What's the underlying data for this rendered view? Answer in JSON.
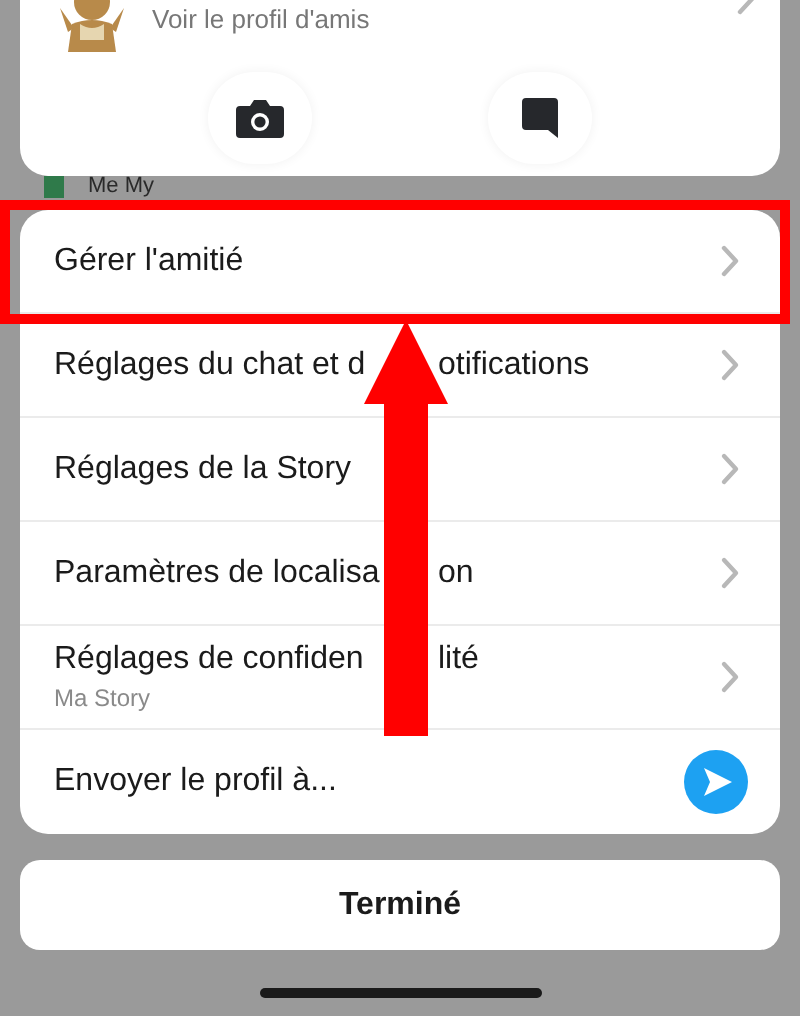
{
  "profile_card": {
    "subtitle": "Voir le profil d'amis",
    "actions": [
      {
        "kind": "camera"
      },
      {
        "kind": "chat"
      }
    ]
  },
  "background_row": {
    "label": "Me My"
  },
  "menu": [
    {
      "label_parts": [
        "Gérer l'amitié"
      ],
      "kind": "chevron",
      "highlighted": true
    },
    {
      "label_parts": [
        "Réglages du chat et d",
        "otifications"
      ],
      "kind": "chevron",
      "highlighted": false
    },
    {
      "label_parts": [
        "Réglages de la Story"
      ],
      "kind": "chevron",
      "highlighted": false
    },
    {
      "label_parts": [
        "Paramètres de localisa",
        "on"
      ],
      "kind": "chevron",
      "highlighted": false
    },
    {
      "label_parts": [
        "Réglages de confiden",
        "lité"
      ],
      "subtitle": "Ma Story",
      "kind": "chevron",
      "highlighted": false
    },
    {
      "label_parts": [
        "Envoyer le profil à..."
      ],
      "kind": "send",
      "highlighted": false
    }
  ],
  "done_button": "Terminé"
}
